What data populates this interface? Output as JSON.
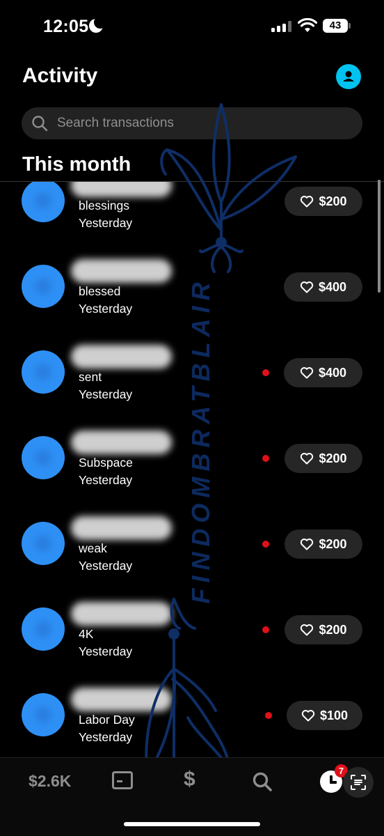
{
  "status_bar": {
    "time": "12:05",
    "battery": "43"
  },
  "header": {
    "title": "Activity"
  },
  "search": {
    "placeholder": "Search transactions"
  },
  "section": {
    "title": "This month"
  },
  "transactions": [
    {
      "note": "blessings",
      "date": "Yesterday",
      "amount": "$200",
      "unread": false
    },
    {
      "note": "blessed",
      "date": "Yesterday",
      "amount": "$400",
      "unread": false
    },
    {
      "note": "sent",
      "date": "Yesterday",
      "amount": "$400",
      "unread": true
    },
    {
      "note": "Subspace",
      "date": "Yesterday",
      "amount": "$200",
      "unread": true
    },
    {
      "note": "weak",
      "date": "Yesterday",
      "amount": "$200",
      "unread": true
    },
    {
      "note": "4K",
      "date": "Yesterday",
      "amount": "$200",
      "unread": true
    },
    {
      "note": "Labor Day",
      "date": "Yesterday",
      "amount": "$100",
      "unread": true
    }
  ],
  "watermark": {
    "text": "FINDOMBRATBLAIR"
  },
  "tabbar": {
    "balance": "$2.6K",
    "dollar": "$",
    "activity_badge": "7"
  },
  "colors": {
    "accent": "#00c3f0",
    "avatar": "#2e90f5",
    "unread_dot": "#e0101a",
    "pill": "#262626",
    "watermark": "#0f2e66"
  }
}
